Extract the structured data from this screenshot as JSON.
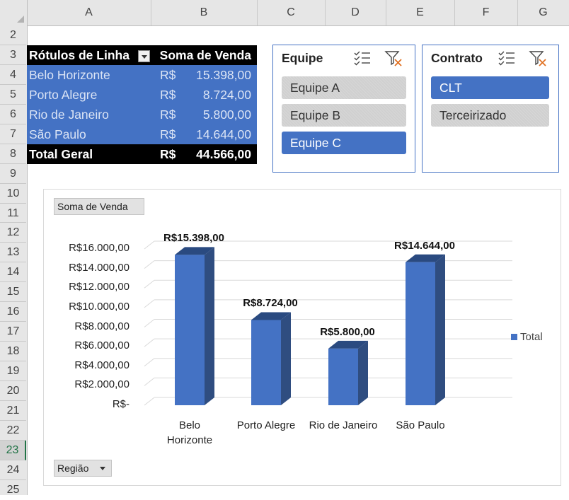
{
  "columns": [
    "A",
    "B",
    "C",
    "D",
    "E",
    "F",
    "G"
  ],
  "rows": [
    "2",
    "3",
    "4",
    "5",
    "6",
    "7",
    "8",
    "9",
    "10",
    "11",
    "12",
    "13",
    "14",
    "15",
    "16",
    "17",
    "18",
    "19",
    "20",
    "21",
    "22",
    "23",
    "24",
    "25"
  ],
  "pivot": {
    "header": {
      "col_a": "Rótulos de Linha",
      "col_b": "Soma de Venda"
    },
    "rows": [
      {
        "label": "Belo Horizonte",
        "currency": "R$",
        "value": "15.398,00"
      },
      {
        "label": "Porto Alegre",
        "currency": "R$",
        "value": "8.724,00"
      },
      {
        "label": "Rio de Janeiro",
        "currency": "R$",
        "value": "5.800,00"
      },
      {
        "label": "São Paulo",
        "currency": "R$",
        "value": "14.644,00"
      }
    ],
    "total": {
      "label": "Total Geral",
      "currency": "R$",
      "value": "44.566,00"
    }
  },
  "slicers": [
    {
      "title": "Equipe",
      "items": [
        {
          "label": "Equipe A",
          "selected": false
        },
        {
          "label": "Equipe B",
          "selected": false
        },
        {
          "label": "Equipe C",
          "selected": true
        }
      ]
    },
    {
      "title": "Contrato",
      "items": [
        {
          "label": "CLT",
          "selected": true
        },
        {
          "label": "Terceirizado",
          "selected": false
        }
      ]
    }
  ],
  "chart_field_buttons": {
    "value_field": "Soma de Venda",
    "axis_field": "Região"
  },
  "colors": {
    "accent": "#4472c4",
    "bar_side": "#2f4d80",
    "bar_top": "#2a4a80",
    "grid": "#d9d9d9"
  },
  "chart_data": {
    "type": "bar",
    "categories": [
      "Belo Horizonte",
      "Porto Alegre",
      "Rio de Janeiro",
      "São Paulo"
    ],
    "category_lines": [
      [
        "Belo",
        "Horizonte"
      ],
      [
        "Porto Alegre"
      ],
      [
        "Rio de Janeiro"
      ],
      [
        "São Paulo"
      ]
    ],
    "series": [
      {
        "name": "Total",
        "values": [
          15398,
          8724,
          5800,
          14644
        ]
      }
    ],
    "data_labels": [
      "R$15.398,00",
      "R$8.724,00",
      "R$5.800,00",
      "R$14.644,00"
    ],
    "yticks": [
      0,
      2000,
      4000,
      6000,
      8000,
      10000,
      12000,
      14000,
      16000
    ],
    "ytick_labels": [
      "R$-",
      "R$2.000,00",
      "R$4.000,00",
      "R$6.000,00",
      "R$8.000,00",
      "R$10.000,00",
      "R$12.000,00",
      "R$14.000,00",
      "R$16.000,00"
    ],
    "ylim": [
      0,
      16000
    ],
    "grid": true,
    "legend": "right",
    "style": "3d-column"
  }
}
